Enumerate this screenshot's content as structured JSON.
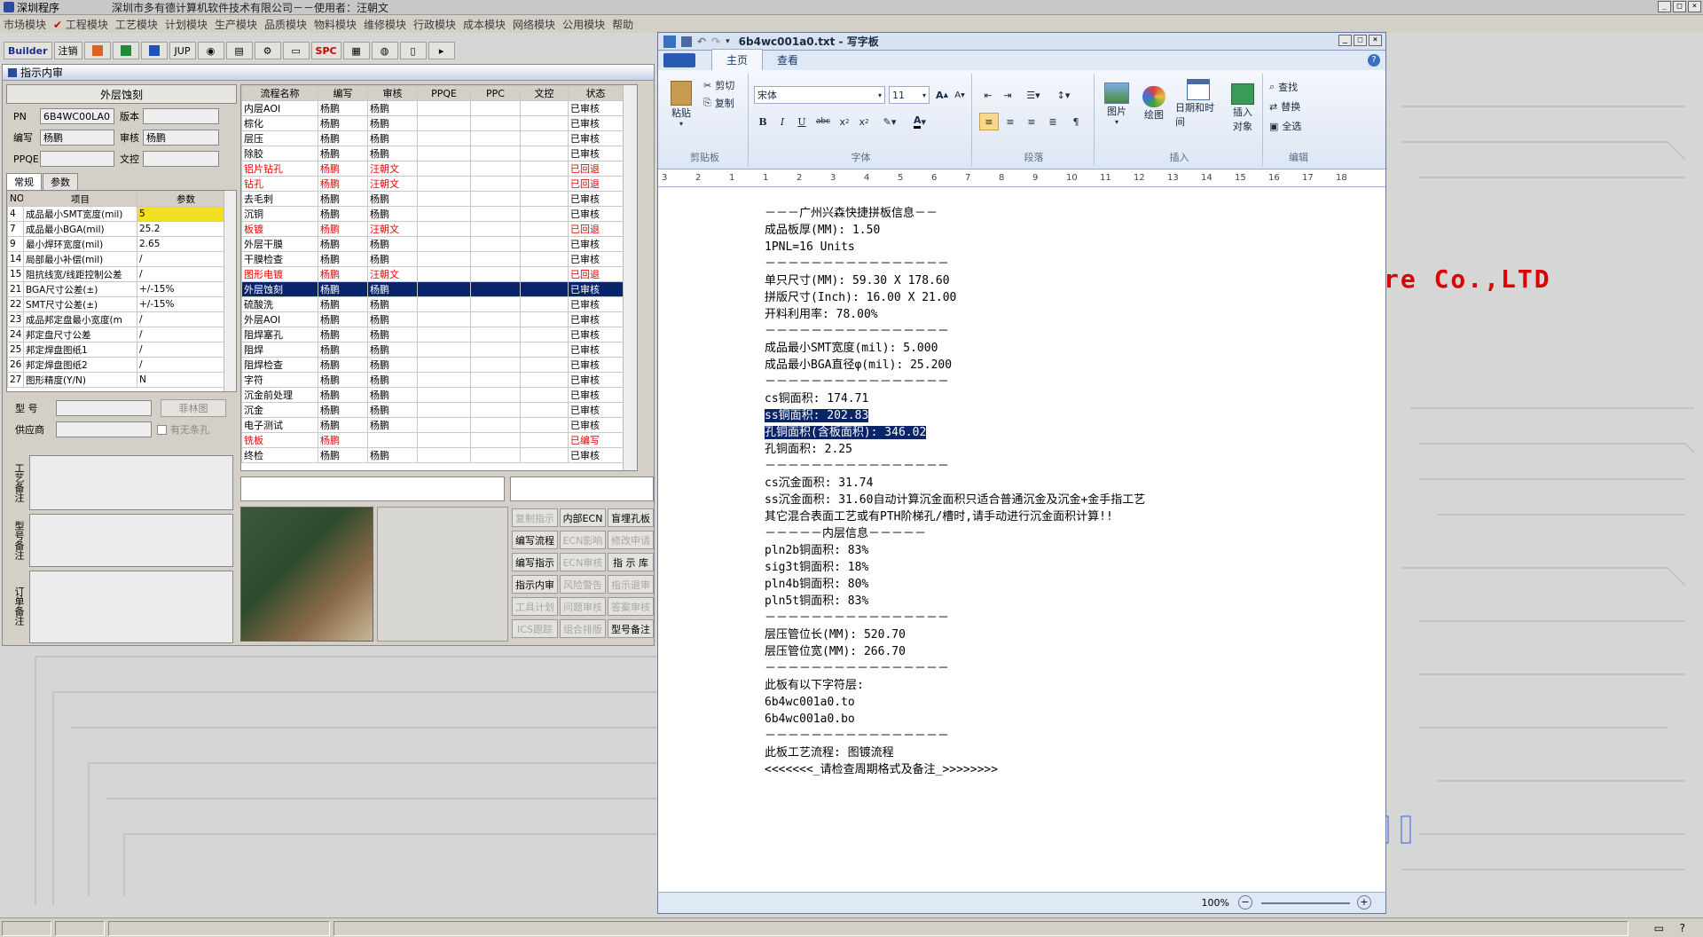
{
  "app": {
    "name": "深圳程序",
    "title": "深圳市多有德计算机软件技术有限公司－－使用者：汪朝文"
  },
  "menu": [
    "市场模块",
    "工程模块",
    "工艺模块",
    "计划模块",
    "生产模块",
    "品质模块",
    "物料模块",
    "维修模块",
    "行政模块",
    "成本模块",
    "网络模块",
    "公用模块",
    "帮助"
  ],
  "toolbar": {
    "builder": "Builder",
    "logout": "注销",
    "jup": "JUP",
    "spc": "SPC"
  },
  "inner_window": {
    "title": "指示内审",
    "process_name": "外层蚀刻",
    "fields": {
      "pn_label": "PN",
      "pn_value": "6B4WC00LA0",
      "version_label": "版本",
      "version_value": "",
      "author_label": "编写",
      "author_value": "杨鹏",
      "review_label": "审核",
      "review_value": "杨鹏",
      "ppqe_label": "PPQE",
      "ppqe_value": "",
      "control_label": "文控",
      "control_value": ""
    },
    "tabs": [
      "常规",
      "参数"
    ],
    "param_headers": [
      "NO",
      "项目",
      "参数"
    ],
    "params": [
      [
        "4",
        "成品最小SMT宽度(mil)",
        "5"
      ],
      [
        "7",
        "成品最小BGA(mil)",
        "25.2"
      ],
      [
        "9",
        "最小焊环宽度(mil)",
        "2.65"
      ],
      [
        "14",
        "局部最小补偿(mil)",
        "/"
      ],
      [
        "15",
        "阻抗线宽/线距控制公差",
        "/"
      ],
      [
        "21",
        "BGA尺寸公差(±)",
        "+/-15%"
      ],
      [
        "22",
        "SMT尺寸公差(±)",
        "+/-15%"
      ],
      [
        "23",
        "成品邦定盘最小宽度(m",
        "/"
      ],
      [
        "24",
        "邦定盘尺寸公差",
        "/"
      ],
      [
        "25",
        "邦定焊盘图纸1",
        "/"
      ],
      [
        "26",
        "邦定焊盘图纸2",
        "/"
      ],
      [
        "27",
        "图形精度(Y/N)",
        "N"
      ]
    ],
    "model_label": "型 号",
    "model_value": "",
    "forest_btn": "菲林图",
    "supplier_label": "供应商",
    "supplier_value": "",
    "no_slot_label": "有无条孔",
    "note1": "工艺备注",
    "note2": "型号备注",
    "note3": "订单备注",
    "flow_headers": [
      "流程名称",
      "编写",
      "审核",
      "PPQE",
      "PPC",
      "文控",
      "状态"
    ],
    "flow_rows": [
      [
        "内层AOI",
        "杨鹏",
        "杨鹏",
        "",
        "",
        "",
        "已审核",
        ""
      ],
      [
        "棕化",
        "杨鹏",
        "杨鹏",
        "",
        "",
        "",
        "已审核",
        ""
      ],
      [
        "层压",
        "杨鹏",
        "杨鹏",
        "",
        "",
        "",
        "已审核",
        ""
      ],
      [
        "除胶",
        "杨鹏",
        "杨鹏",
        "",
        "",
        "",
        "已审核",
        ""
      ],
      [
        "铝片钻孔",
        "杨鹏",
        "汪朝文",
        "",
        "",
        "",
        "已回退",
        "red"
      ],
      [
        "钻孔",
        "杨鹏",
        "汪朝文",
        "",
        "",
        "",
        "已回退",
        "red"
      ],
      [
        "去毛刺",
        "杨鹏",
        "杨鹏",
        "",
        "",
        "",
        "已审核",
        ""
      ],
      [
        "沉铜",
        "杨鹏",
        "杨鹏",
        "",
        "",
        "",
        "已审核",
        ""
      ],
      [
        "板镀",
        "杨鹏",
        "汪朝文",
        "",
        "",
        "",
        "已回退",
        "red"
      ],
      [
        "外层干膜",
        "杨鹏",
        "杨鹏",
        "",
        "",
        "",
        "已审核",
        ""
      ],
      [
        "干膜检查",
        "杨鹏",
        "杨鹏",
        "",
        "",
        "",
        "已审核",
        ""
      ],
      [
        "图形电镀",
        "杨鹏",
        "汪朝文",
        "",
        "",
        "",
        "已回退",
        "red"
      ],
      [
        "外层蚀刻",
        "杨鹏",
        "杨鹏",
        "",
        "",
        "",
        "已审核",
        "sel"
      ],
      [
        "硫酸洗",
        "杨鹏",
        "杨鹏",
        "",
        "",
        "",
        "已审核",
        ""
      ],
      [
        "外层AOI",
        "杨鹏",
        "杨鹏",
        "",
        "",
        "",
        "已审核",
        ""
      ],
      [
        "阻焊塞孔",
        "杨鹏",
        "杨鹏",
        "",
        "",
        "",
        "已审核",
        ""
      ],
      [
        "阻焊",
        "杨鹏",
        "杨鹏",
        "",
        "",
        "",
        "已审核",
        ""
      ],
      [
        "阻焊检查",
        "杨鹏",
        "杨鹏",
        "",
        "",
        "",
        "已审核",
        ""
      ],
      [
        "字符",
        "杨鹏",
        "杨鹏",
        "",
        "",
        "",
        "已审核",
        ""
      ],
      [
        "沉金前处理",
        "杨鹏",
        "杨鹏",
        "",
        "",
        "",
        "已审核",
        ""
      ],
      [
        "沉金",
        "杨鹏",
        "杨鹏",
        "",
        "",
        "",
        "已审核",
        ""
      ],
      [
        "电子测试",
        "杨鹏",
        "杨鹏",
        "",
        "",
        "",
        "已审核",
        ""
      ],
      [
        "铣板",
        "杨鹏",
        "",
        "",
        "",
        "",
        "已编写",
        "red"
      ],
      [
        "终检",
        "杨鹏",
        "杨鹏",
        "",
        "",
        "",
        "已审核",
        ""
      ]
    ],
    "buttons": [
      [
        "复制指示",
        "内部ECN",
        "盲埋孔板"
      ],
      [
        "编写流程",
        "ECN影响",
        "修改申请"
      ],
      [
        "编写指示",
        "ECN审核",
        "指 示 库"
      ],
      [
        "指示内审",
        "风险警告",
        "指示退审"
      ],
      [
        "工具计划",
        "问题审核",
        "答案审核"
      ],
      [
        "ICS跟踪",
        "组合排版",
        "型号备注"
      ]
    ],
    "button_disabled": [
      [
        true,
        false,
        false
      ],
      [
        false,
        true,
        true
      ],
      [
        false,
        true,
        false
      ],
      [
        false,
        true,
        true
      ],
      [
        true,
        true,
        true
      ],
      [
        true,
        true,
        false
      ]
    ]
  },
  "wordpad": {
    "title": "6b4wc001a0.txt - 写字板",
    "tabs": [
      "主页",
      "查看"
    ],
    "clipboard": {
      "paste": "粘贴",
      "cut": "剪切",
      "copy": "复制",
      "label": "剪贴板"
    },
    "font": {
      "name": "宋体",
      "size": "11",
      "label": "字体"
    },
    "paragraph_label": "段落",
    "insert": {
      "picture": "图片",
      "paint": "绘图",
      "datetime": "日期和时间",
      "object": "插入\n对象",
      "label": "插入"
    },
    "edit": {
      "find": "查找",
      "replace": "替换",
      "selectall": "全选",
      "label": "编辑"
    },
    "ruler": [
      "3",
      "2",
      "1",
      "1",
      "2",
      "3",
      "4",
      "5",
      "6",
      "7",
      "8",
      "9",
      "10",
      "11",
      "12",
      "13",
      "14",
      "15",
      "16",
      "17",
      "18"
    ],
    "lines": [
      "－－－广州兴森快捷拼板信息－－",
      "成品板厚(MM): 1.50",
      "1PNL=16 Units",
      "－－－－－－－－－－－－－－－－",
      "单只尺寸(MM): 59.30 X 178.60",
      "拼版尺寸(Inch): 16.00 X 21.00",
      "开料利用率: 78.00%",
      "－－－－－－－－－－－－－－－－",
      "成品最小SMT宽度(mil): 5.000",
      "成品最小BGA直径φ(mil): 25.200",
      "－－－－－－－－－－－－－－－－",
      "cs铜面积: 174.71",
      "ss铜面积: 202.83",
      "孔铜面积(含板面积): 346.02",
      "孔铜面积: 2.25",
      "－－－－－－－－－－－－－－－－",
      "cs沉金面积: 31.74",
      "ss沉金面积: 31.60自动计算沉金面积只适合普通沉金及沉金+金手指工艺",
      "其它混合表面工艺或有PTH阶梯孔/槽时,请手动进行沉金面积计算!!",
      "－－－－－内层信息－－－－－",
      "pln2b铜面积: 83%",
      "sig3t铜面积: 18%",
      "pln4b铜面积: 80%",
      "pln5t铜面积: 83%",
      "－－－－－－－－－－－－－－－－",
      "层压管位长(MM): 520.70",
      "层压管位宽(MM): 266.70",
      "－－－－－－－－－－－－－－－－",
      "此板有以下字符层:",
      "6b4wc001a0.to",
      "6b4wc001a0.bo",
      "－－－－－－－－－－－－－－－－",
      "此板工艺流程: 图镀流程",
      "<<<<<<<_请检查周期格式及备注_>>>>>>>>"
    ],
    "highlight_lines": [
      12,
      13
    ],
    "zoom": "100%"
  },
  "background_text": "re Co.,LTD"
}
